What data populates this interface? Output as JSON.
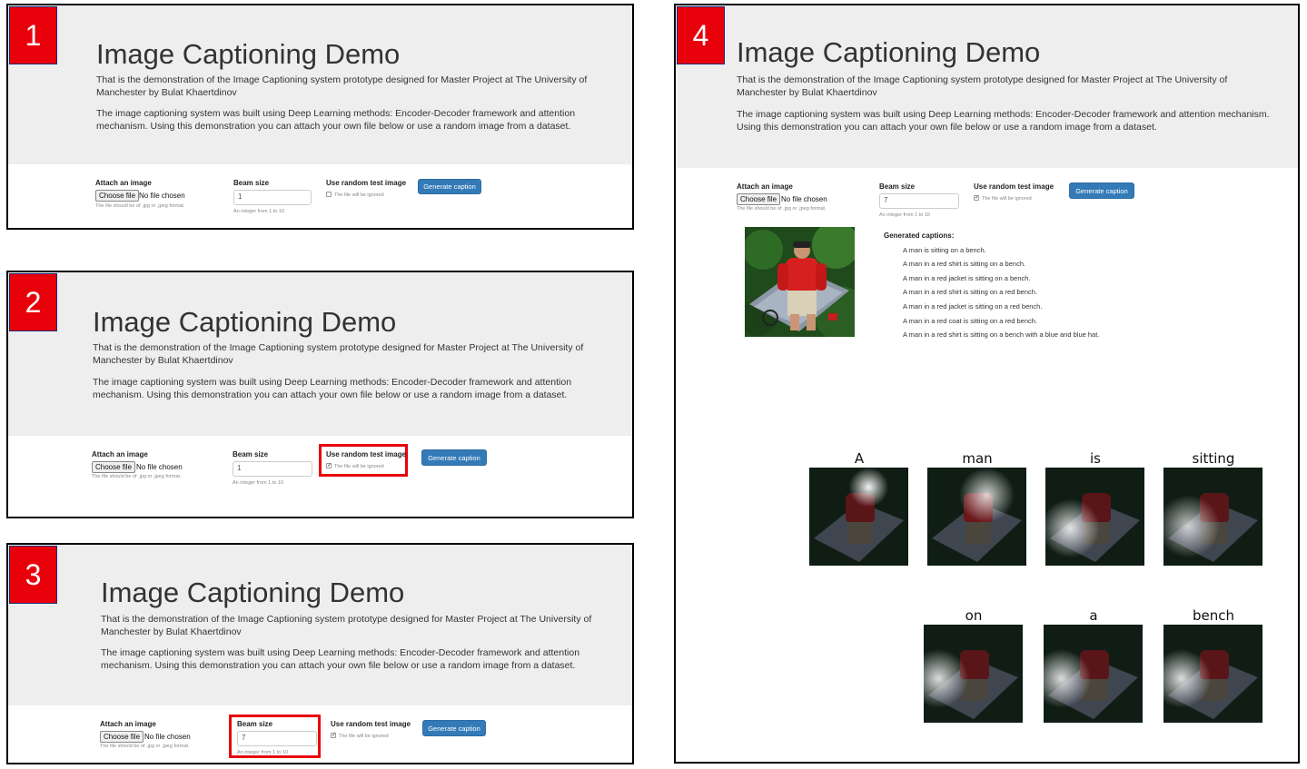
{
  "demo": {
    "title": "Image Captioning Demo",
    "intro": "That is the demonstration of the Image Captioning system prototype designed for Master Project at The University of Manchester by Bulat Khaertdinov",
    "description": "The image captioning system was built using Deep Learning methods: Encoder-Decoder framework and attention mechanism. Using this demonstration you can attach your own file below or use a random image from a dataset.",
    "attach_label": "Attach an image",
    "choose_file_label": "Choose file",
    "no_file_text": "No file chosen",
    "file_help": "The file should be of .jpg or .jpeg format.",
    "beam_label": "Beam size",
    "beam_help": "An integer from 1 to 10",
    "random_label": "Use random test image",
    "random_help": "The file will be ignored",
    "generate_label": "Generate caption"
  },
  "steps": [
    {
      "number": "1",
      "beam_value": "1",
      "random_checked": false
    },
    {
      "number": "2",
      "beam_value": "1",
      "random_checked": true
    },
    {
      "number": "3",
      "beam_value": "7",
      "random_checked": true
    },
    {
      "number": "4",
      "beam_value": "7",
      "random_checked": true
    }
  ],
  "results": {
    "heading": "Generated captions:",
    "captions": [
      "A man is sitting on a bench.",
      "A man in a red shirt is sitting on a bench.",
      "A man in a red jacket is sitting on a bench.",
      "A man in a red shirt is sitting on a red bench.",
      "A man in a red jacket is sitting on a red bench.",
      "A man in a red coat is sitting on a red bench.",
      "A man in a red shirt is sitting on a bench with a blue and blue hat."
    ],
    "attention_words": [
      "A",
      "man",
      "is",
      "sitting",
      "on",
      "a",
      "bench"
    ]
  },
  "colors": {
    "badge": "#e8000b",
    "jumbotron": "#eeeeee",
    "button": "#337ab7",
    "highlight": "#e8000b"
  }
}
